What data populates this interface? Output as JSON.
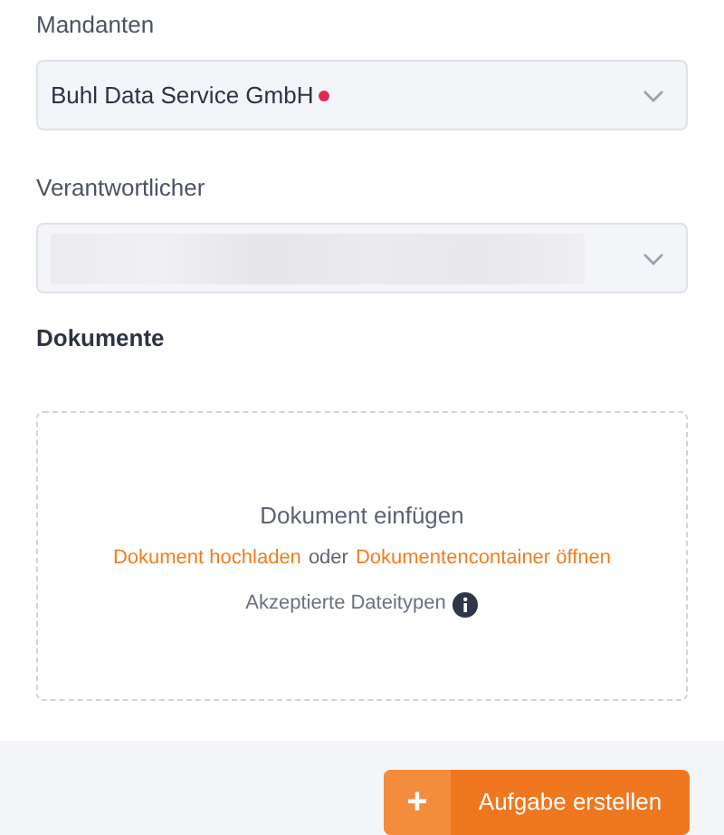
{
  "fields": [
    {
      "label": "Mandanten",
      "value": "Buhl Data Service GmbH",
      "required": true,
      "redacted": false
    },
    {
      "label": "Verantwortlicher",
      "required": false,
      "redacted": true
    }
  ],
  "documents": {
    "label": "Dokumente",
    "title": "Dokument einfügen",
    "upload_link": "Dokument hochladen",
    "connector": "oder",
    "container_link": "Dokumentencontainer öffnen",
    "accepted_types": "Akzeptierte Dateitypen"
  },
  "footer": {
    "button_icon": "+",
    "button_label": "Aufgabe erstellen"
  }
}
